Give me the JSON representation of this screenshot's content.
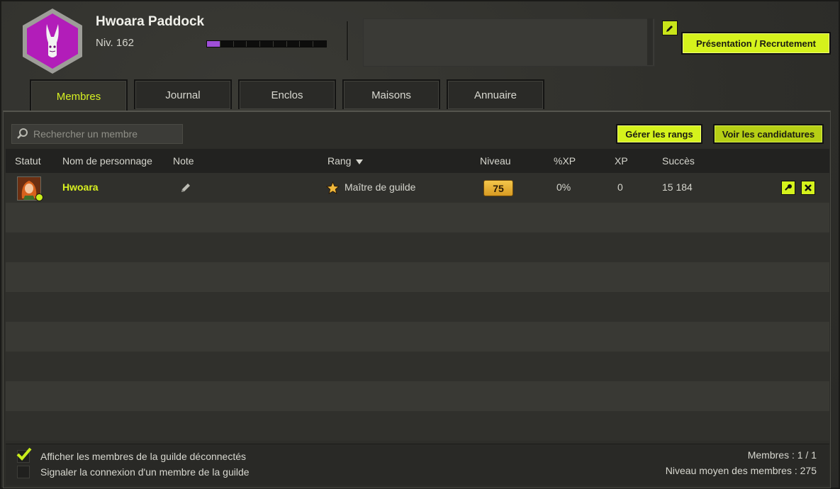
{
  "guild": {
    "name": "Hwoara Paddock",
    "level_text": "Niv. 162",
    "xp_progress": 0.11
  },
  "header": {
    "recruit_label": "Présentation / Recrutement"
  },
  "tabs": [
    {
      "label": "Membres",
      "active": true
    },
    {
      "label": "Journal",
      "active": false
    },
    {
      "label": "Enclos",
      "active": false
    },
    {
      "label": "Maisons",
      "active": false
    },
    {
      "label": "Annuaire",
      "active": false
    }
  ],
  "search": {
    "placeholder": "Rechercher un membre"
  },
  "actions": {
    "ranks_label": "Gérer les rangs",
    "candidates_label": "Voir les candidatures"
  },
  "table": {
    "headers": {
      "status": "Statut",
      "name": "Nom de personnage",
      "note": "Note",
      "rank": "Rang",
      "level": "Niveau",
      "xp_pct": "%XP",
      "xp": "XP",
      "success": "Succès"
    },
    "rows": [
      {
        "name": "Hwoara",
        "online": true,
        "rank": "Maître de guilde",
        "level": "75",
        "xp_pct": "0%",
        "xp": "0",
        "success": "15 184"
      }
    ]
  },
  "footer": {
    "show_offline_label": "Afficher les membres de la guilde déconnectés",
    "show_offline_checked": true,
    "notify_label": "Signaler la connexion d'un membre de la guilde",
    "notify_checked": false,
    "members_count": "Membres : 1 / 1",
    "avg_level": "Niveau moyen des membres : 275"
  },
  "colors": {
    "accent": "#d5f21c",
    "emblem": "#b021b8",
    "xp_bar": "#9f4fd8",
    "level_badge": "#e8b43a"
  },
  "icons": [
    "rabbit-emblem-icon",
    "pencil-icon",
    "search-icon",
    "sort-down-icon",
    "star-icon",
    "key-icon",
    "close-icon",
    "checkmark-icon"
  ]
}
